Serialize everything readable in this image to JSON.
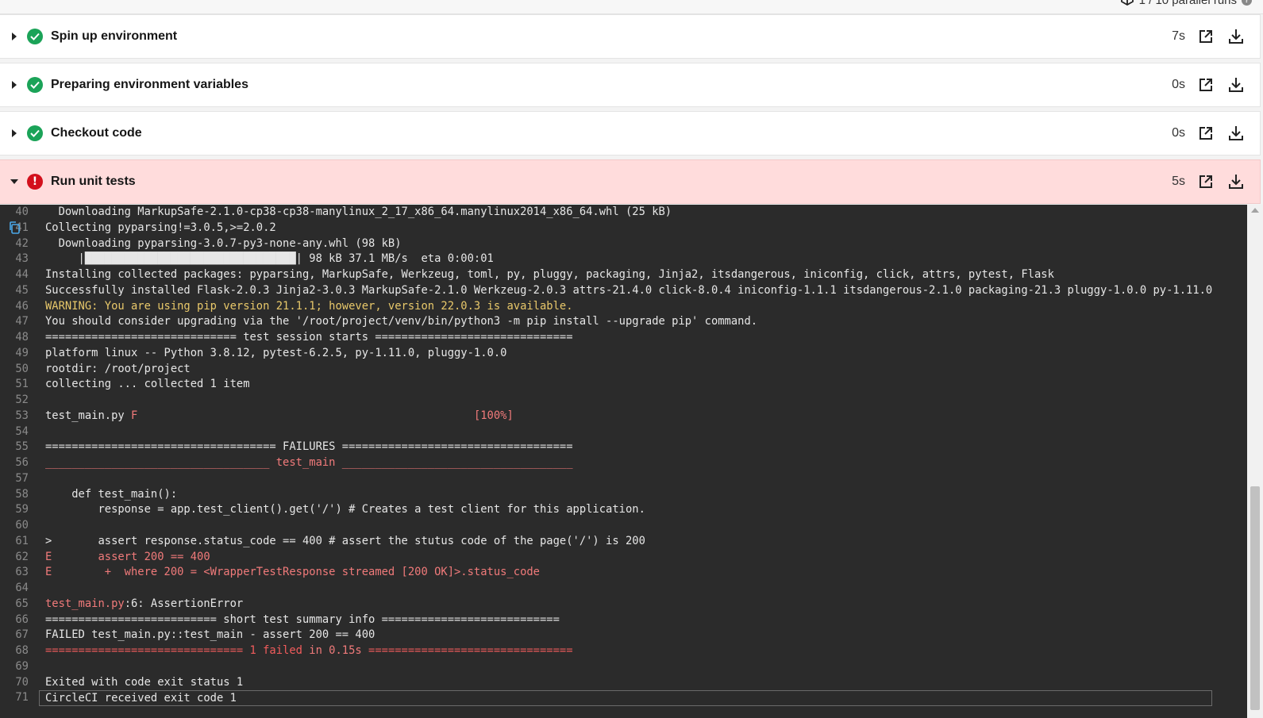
{
  "header": {
    "parallel_runs_label": "1 / 10 parallel runs"
  },
  "steps": [
    {
      "title": "Spin up environment",
      "duration": "7s",
      "status": "success"
    },
    {
      "title": "Preparing environment variables",
      "duration": "0s",
      "status": "success"
    },
    {
      "title": "Checkout code",
      "duration": "0s",
      "status": "success"
    },
    {
      "title": "Run unit tests",
      "duration": "5s",
      "status": "failed"
    }
  ],
  "icons": {
    "expand": "caret-right-icon",
    "collapse": "caret-down-icon",
    "success": "check-circle-icon",
    "failed": "exclamation-circle-icon",
    "open": "external-link-icon",
    "download": "download-icon",
    "copy": "copy-icon"
  },
  "colors": {
    "success": "#1ba358",
    "failed": "#d3101c",
    "failed_bg": "#ffdcdc",
    "terminal_bg": "#2b2b2b",
    "warning_text": "#e8c86a",
    "error_text": "#f07a7a"
  },
  "log": {
    "lines": [
      {
        "n": "40",
        "segments": [
          {
            "t": "  Downloading MarkupSafe-2.1.0-cp38-cp38-manylinux_2_17_x86_64.manylinux2014_x86_64.whl (25 kB)",
            "c": ""
          }
        ]
      },
      {
        "n": "41",
        "segments": [
          {
            "t": "Collecting pyparsing!=3.0.5,>=2.0.2",
            "c": ""
          }
        ]
      },
      {
        "n": "42",
        "segments": [
          {
            "t": "  Downloading pyparsing-3.0.7-py3-none-any.whl (98 kB)",
            "c": ""
          }
        ]
      },
      {
        "n": "43",
        "segments": [
          {
            "t": "     |████████████████████████████████| 98 kB 37.1 MB/s  eta 0:00:01",
            "c": ""
          }
        ]
      },
      {
        "n": "44",
        "segments": [
          {
            "t": "Installing collected packages: pyparsing, MarkupSafe, Werkzeug, toml, py, pluggy, packaging, Jinja2, itsdangerous, iniconfig, click, attrs, pytest, Flask",
            "c": ""
          }
        ]
      },
      {
        "n": "45",
        "segments": [
          {
            "t": "Successfully installed Flask-2.0.3 Jinja2-3.0.3 MarkupSafe-2.1.0 Werkzeug-2.0.3 attrs-21.4.0 click-8.0.4 iniconfig-1.1.1 itsdangerous-2.1.0 packaging-21.3 pluggy-1.0.0 py-1.11.0",
            "c": ""
          }
        ]
      },
      {
        "n": "46",
        "segments": [
          {
            "t": "WARNING: You are using pip version 21.1.1; however, version 22.0.3 is available.",
            "c": "y"
          }
        ]
      },
      {
        "n": "47",
        "segments": [
          {
            "t": "You should consider upgrading via the '/root/project/venv/bin/python3 -m pip install --upgrade pip' command.",
            "c": ""
          }
        ]
      },
      {
        "n": "48",
        "segments": [
          {
            "t": "============================= test session starts ==============================",
            "c": ""
          }
        ]
      },
      {
        "n": "49",
        "segments": [
          {
            "t": "platform linux -- Python 3.8.12, pytest-6.2.5, py-1.11.0, pluggy-1.0.0",
            "c": ""
          }
        ]
      },
      {
        "n": "50",
        "segments": [
          {
            "t": "rootdir: /root/project",
            "c": ""
          }
        ]
      },
      {
        "n": "51",
        "segments": [
          {
            "t": "collecting ... collected 1 item",
            "c": ""
          }
        ]
      },
      {
        "n": "52",
        "segments": []
      },
      {
        "n": "53",
        "segments": [
          {
            "t": "test_main.py ",
            "c": ""
          },
          {
            "t": "F",
            "c": "r"
          },
          {
            "t": "                                                   ",
            "c": ""
          },
          {
            "t": "[100%]",
            "c": "r"
          }
        ]
      },
      {
        "n": "54",
        "segments": []
      },
      {
        "n": "55",
        "segments": [
          {
            "t": "=================================== FAILURES ===================================",
            "c": ""
          }
        ]
      },
      {
        "n": "56",
        "segments": [
          {
            "t": "__________________________________ test_main ___________________________________",
            "c": "r"
          }
        ]
      },
      {
        "n": "57",
        "segments": []
      },
      {
        "n": "58",
        "segments": [
          {
            "t": "    def test_main():",
            "c": ""
          }
        ]
      },
      {
        "n": "59",
        "segments": [
          {
            "t": "        response = app.test_client().get('/') # Creates a test client for this application.",
            "c": ""
          }
        ]
      },
      {
        "n": "60",
        "segments": []
      },
      {
        "n": "61",
        "segments": [
          {
            "t": ">       assert response.status_code == 400 # assert the stutus code of the page('/') is 200",
            "c": ""
          }
        ]
      },
      {
        "n": "62",
        "segments": [
          {
            "t": "E       assert 200 == 400",
            "c": "r"
          }
        ]
      },
      {
        "n": "63",
        "segments": [
          {
            "t": "E        +  where 200 = <WrapperTestResponse streamed [200 OK]>.status_code",
            "c": "r"
          }
        ]
      },
      {
        "n": "64",
        "segments": []
      },
      {
        "n": "65",
        "segments": [
          {
            "t": "test_main.py",
            "c": "r"
          },
          {
            "t": ":6: AssertionError",
            "c": ""
          }
        ]
      },
      {
        "n": "66",
        "segments": [
          {
            "t": "========================== short test summary info ===========================",
            "c": ""
          }
        ]
      },
      {
        "n": "67",
        "segments": [
          {
            "t": "FAILED test_main.py::test_main - assert 200 == 400",
            "c": ""
          }
        ]
      },
      {
        "n": "68",
        "segments": [
          {
            "t": "============================== ",
            "c": "r2"
          },
          {
            "t": "1 failed",
            "c": "r2"
          },
          {
            "t": " in 0.15s",
            "c": "r"
          },
          {
            "t": " ===============================",
            "c": "r2"
          }
        ]
      },
      {
        "n": "69",
        "segments": []
      },
      {
        "n": "70",
        "segments": [
          {
            "t": "Exited with code exit status 1",
            "c": ""
          }
        ]
      },
      {
        "n": "71",
        "segments": [
          {
            "t": "CircleCI received exit code 1",
            "c": ""
          }
        ],
        "boxed": true
      }
    ]
  }
}
